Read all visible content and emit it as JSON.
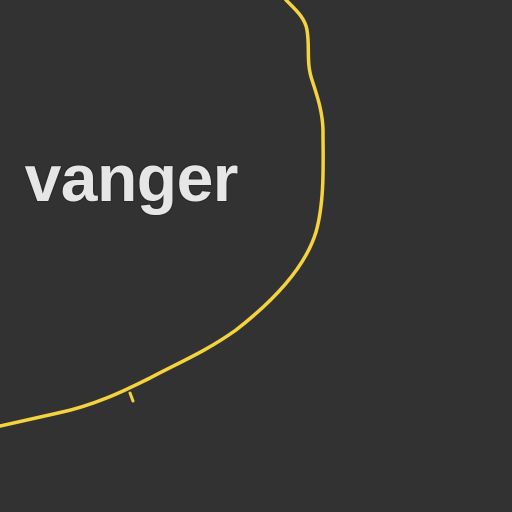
{
  "map": {
    "background_color": "#323232",
    "boundary_color": "#f5d33f",
    "label_color": "#e6e6e6",
    "place_label": "vanger"
  }
}
